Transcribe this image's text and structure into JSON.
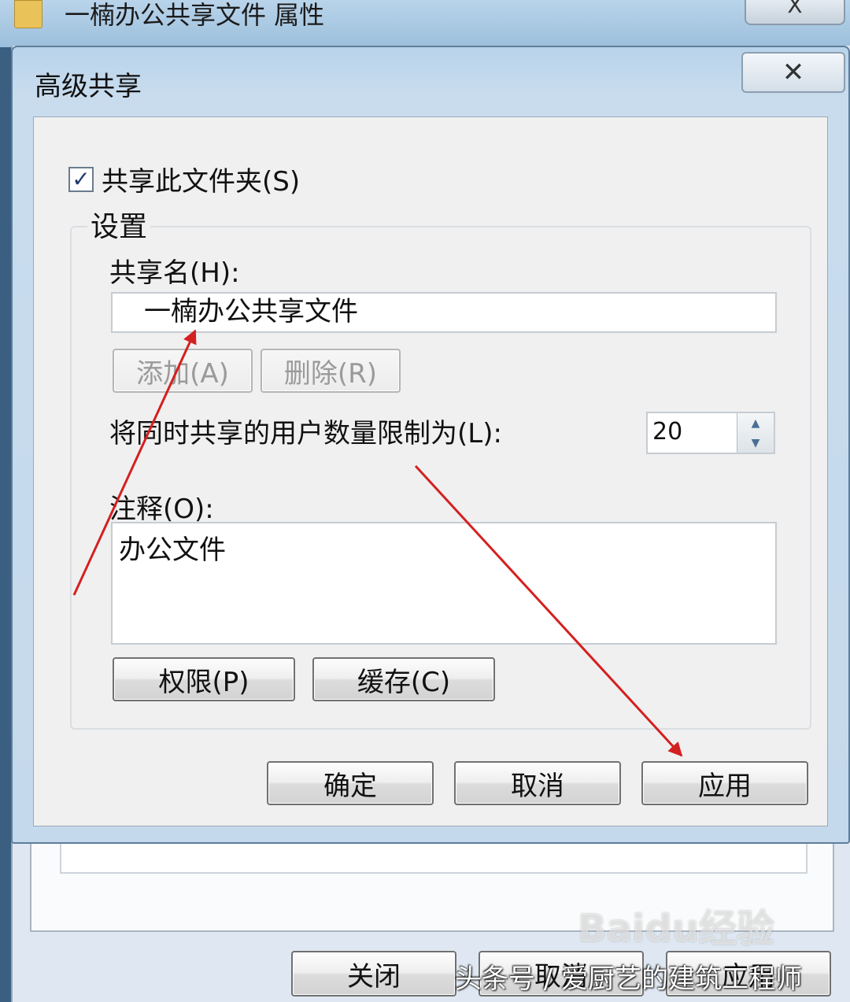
{
  "parent_window": {
    "title": "一楠办公共享文件 属性",
    "close_glyph": "X",
    "buttons": {
      "close": "关闭",
      "cancel": "取消",
      "apply": "应用"
    }
  },
  "dialog": {
    "title": "高级共享",
    "close_glyph": "✕",
    "share_checkbox": {
      "label": "共享此文件夹(S)",
      "checked": true,
      "mark": "✓"
    },
    "settings_legend": "设置",
    "share_name": {
      "label": "共享名(H):",
      "value": "一楠办公共享文件"
    },
    "add_button": "添加(A)",
    "remove_button": "删除(R)",
    "user_limit": {
      "label": "将同时共享的用户数量限制为(L):",
      "value": "20"
    },
    "comment": {
      "label": "注释(O):",
      "value": "办公文件"
    },
    "permissions_button": "权限(P)",
    "caching_button": "缓存(C)",
    "ok_button": "确定",
    "cancel_button": "取消",
    "apply_button": "应用"
  },
  "annotations": {
    "arrow_color": "#d42020"
  },
  "watermark": "Baidu经验",
  "footer_caption": "头条号 / 爱厨艺的建筑工程师"
}
